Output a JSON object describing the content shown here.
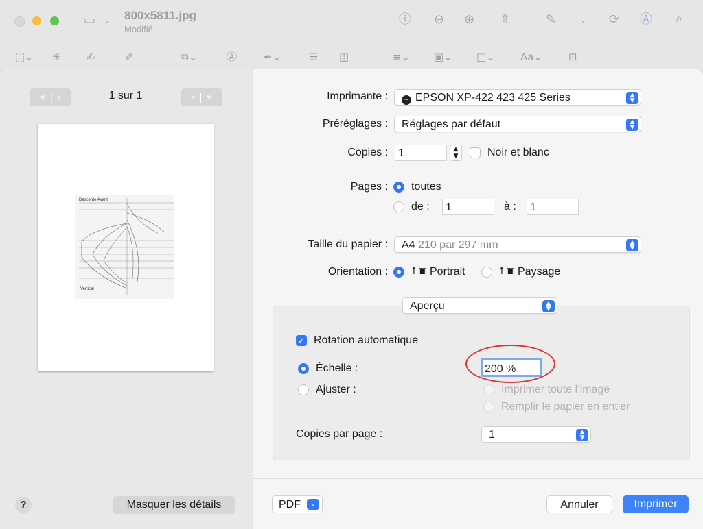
{
  "window": {
    "title": "800x5811.jpg",
    "subtitle": "Modifié"
  },
  "colors": {
    "accent": "#3478f6",
    "highlight_ring": "#e0322b"
  },
  "preview": {
    "page_indicator": "1 sur 1",
    "thumb_title": "Descente Avant",
    "thumb_caption": "Vertical",
    "hide_details_label": "Masquer les détails",
    "help_label": "?"
  },
  "printer": {
    "label": "Imprimante :",
    "value": "EPSON XP-422 423 425 Series"
  },
  "presets": {
    "label": "Préréglages :",
    "value": "Réglages par défaut"
  },
  "copies": {
    "label": "Copies :",
    "value": "1",
    "bw_label": "Noir et blanc"
  },
  "pages": {
    "label": "Pages :",
    "all_label": "toutes",
    "from_label": "de :",
    "from_value": "1",
    "to_label": "à :",
    "to_value": "1"
  },
  "paper": {
    "label": "Taille du papier :",
    "value_name": "A4",
    "value_dims": "210 par 297 mm"
  },
  "orientation": {
    "label": "Orientation :",
    "portrait_label": "Portrait",
    "landscape_label": "Paysage"
  },
  "section_popup": {
    "value": "Aperçu"
  },
  "preview_options": {
    "auto_rotate_label": "Rotation automatique",
    "scale_label": "Échelle :",
    "scale_value": "200 %",
    "fit_label": "Ajuster :",
    "print_whole_label": "Imprimer toute l’image",
    "fill_paper_label": "Remplir le papier en entier",
    "copies_per_page_label": "Copies par page :",
    "copies_per_page_value": "1"
  },
  "footer": {
    "pdf_label": "PDF",
    "cancel_label": "Annuler",
    "print_label": "Imprimer"
  }
}
